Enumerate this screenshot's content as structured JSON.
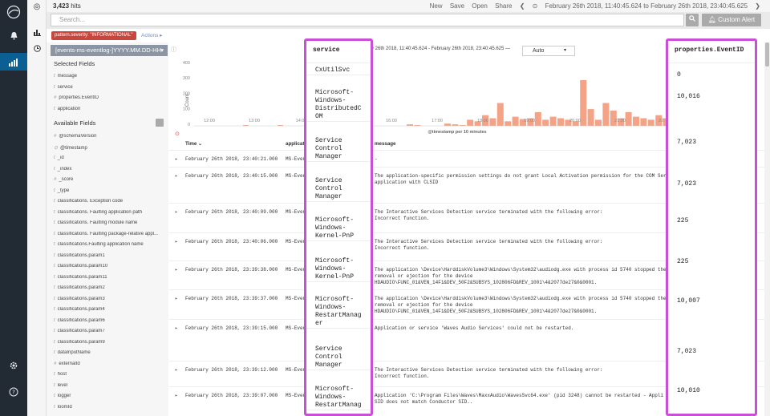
{
  "topbar": {
    "hits": "3,423",
    "hits_suffix": " hits",
    "links": [
      "New",
      "Save",
      "Open",
      "Share"
    ],
    "time_range": "February 26th 2018, 11:40:45.624 to February 26th 2018, 23:40:45.625"
  },
  "search": {
    "placeholder": "Search...",
    "custom_alert": "Custom Alert"
  },
  "filter": {
    "pill": "pattern.severity: \"INFORMATIONAL\"",
    "actions": "Actions ▸"
  },
  "sidebar": {
    "index": "[events-ms-eventlog-]YYYY.MM.DD-HH",
    "selected_title": "Selected Fields",
    "selected": [
      {
        "type": "t",
        "name": "message"
      },
      {
        "type": "t",
        "name": "service"
      },
      {
        "type": "#",
        "name": "properties.EventID"
      },
      {
        "type": "t",
        "name": "application"
      }
    ],
    "available_title": "Available Fields",
    "available": [
      {
        "type": "#",
        "name": "@schemaVersion"
      },
      {
        "type": "⊙",
        "name": "@timestamp"
      },
      {
        "type": "t",
        "name": "_id"
      },
      {
        "type": "t",
        "name": "_index"
      },
      {
        "type": "#",
        "name": "_score"
      },
      {
        "type": "t",
        "name": "_type"
      },
      {
        "type": "t",
        "name": "classifications. Exception code"
      },
      {
        "type": "t",
        "name": "classifications. Faulting application path"
      },
      {
        "type": "t",
        "name": "classifications. Faulting module name"
      },
      {
        "type": "t",
        "name": "classifications. Faulting package-relative appl..."
      },
      {
        "type": "t",
        "name": "classifications.Faulting application name"
      },
      {
        "type": "t",
        "name": "classifications.param1"
      },
      {
        "type": "t",
        "name": "classifications.param10"
      },
      {
        "type": "t",
        "name": "classifications.param11"
      },
      {
        "type": "t",
        "name": "classifications.param2"
      },
      {
        "type": "t",
        "name": "classifications.param3"
      },
      {
        "type": "t",
        "name": "classifications.param4"
      },
      {
        "type": "t",
        "name": "classifications.param6"
      },
      {
        "type": "t",
        "name": "classifications.param7"
      },
      {
        "type": "t",
        "name": "classifications.param9"
      },
      {
        "type": "t",
        "name": "dataInputName"
      },
      {
        "type": "#",
        "name": "externalId"
      },
      {
        "type": "t",
        "name": "host"
      },
      {
        "type": "t",
        "name": "level"
      },
      {
        "type": "t",
        "name": "logger"
      },
      {
        "type": "t",
        "name": "loomId"
      }
    ]
  },
  "histogram": {
    "date_range": "y 26th 2018, 11:40:45.624 - February 26th 2018, 23:40:45.625 —",
    "interval": "Auto",
    "y_label": "Count",
    "y_ticks": [
      "400",
      "300",
      "200",
      "100",
      "0"
    ],
    "x_ticks": [
      "12:00",
      "13:00",
      "14:0",
      "16:00",
      "17:00",
      "18:00",
      "19:00",
      "20:00",
      "21:00",
      "22:"
    ],
    "x_label": "@timestamp per 10 minutes",
    "bar_color": "#f4a386"
  },
  "table": {
    "headers": {
      "time": "Time ⌄",
      "app": "applicat",
      "msg": "message"
    },
    "rows": [
      {
        "time": "February 26th 2018, 23:40:21.000",
        "app": "MS-Even",
        "msg": "-"
      },
      {
        "time": "February 26th 2018, 23:40:15.000",
        "app": "MS-Even",
        "msg": "The application-specific permission settings do not grant Local Activation permission for the COM Ser\napplication with CLSID"
      },
      {
        "time": "February 26th 2018, 23:40:09.000",
        "app": "MS-Even",
        "msg": "The Interactive Services Detection service terminated with the following error:\nIncorrect function."
      },
      {
        "time": "February 26th 2018, 23:40:06.000",
        "app": "MS-Even",
        "msg": "The Interactive Services Detection service terminated with the following error:\nIncorrect function."
      },
      {
        "time": "February 26th 2018, 23:39:38.000",
        "app": "MS-Even",
        "msg": "The application \\Device\\HarddiskVolume3\\Windows\\System32\\audiodg.exe with process id 5740 stopped the\nremoval or ejection for the device\nHDAUDIO\\FUNC_01&VEN_14F1&DEV_50F2&SUBSYS_102806FD&REV_1001\\4&2077de27&0&0001."
      },
      {
        "time": "February 26th 2018, 23:39:37.000",
        "app": "MS-Even",
        "msg": "The application \\Device\\HarddiskVolume3\\Windows\\System32\\audiodg.exe with process id 5740 stopped the\nremoval or ejection for the device\nHDAUDIO\\FUNC_01&VEN_14F1&DEV_50F2&SUBSYS_102806FD&REV_1001\\4&2077de27&0&0001."
      },
      {
        "time": "February 26th 2018, 23:39:15.000",
        "app": "MS-Even",
        "msg": "Application or service 'Waves Audio Services' could not be restarted."
      },
      {
        "time": "February 26th 2018, 23:39:12.000",
        "app": "MS-Even",
        "msg": "The Interactive Services Detection service terminated with the following error:\nIncorrect function."
      },
      {
        "time": "February 26th 2018, 23:39:07.000",
        "app": "MS-Even",
        "msg": "Application 'C:\\Program Files\\Waves\\MaxxAudio\\WavesSvc64.exe' (pid 3248) cannot be restarted - Appli\nSID does not match Conductor SID.."
      }
    ]
  },
  "service_col": {
    "header": "service",
    "cells": [
      "CxUtilSvc",
      "Microsoft-\nWindows-\nDistributedC\nOM",
      "Service\nControl\nManager",
      "Service\nControl\nManager",
      "Microsoft-\nWindows-\nKernel-PnP",
      "Microsoft-\nWindows-\nKernel-PnP",
      "Microsoft-\nWindows-\nRestartManag\ner",
      "Service\nControl\nManager",
      "Microsoft-\nWindows-\nRestartManag"
    ]
  },
  "eventid_col": {
    "header": "properties.EventID",
    "cells": [
      "0",
      "10,016",
      "7,023",
      "7,023",
      "225",
      "225",
      "10,007",
      "7,023",
      "10,010"
    ]
  },
  "colors": {
    "highlight": "#c84fd6",
    "nav_bg": "#222b33",
    "pill": "#c9463d"
  }
}
